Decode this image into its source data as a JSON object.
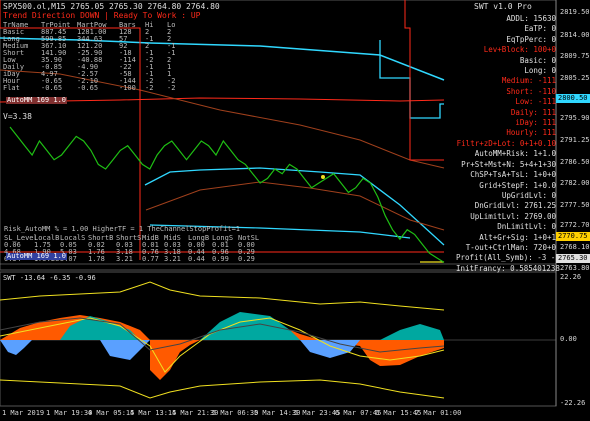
{
  "window": {
    "chart_title": "SPX500.ol,M15  2765.05 2765.30 2764.80 2764.80",
    "indicator_title": "SWT v1.0 Pro",
    "subwindow_title": "SWT -13.64 -6.35 -0.96",
    "trend_header": "Trend Direction   DOWN  |  Ready To Work : UP"
  },
  "top_table": {
    "headers": [
      "TrName",
      "TrPoint",
      "MartPow",
      "Bars",
      "Hi",
      "Lo"
    ],
    "rows": [
      [
        "Basic",
        "887.45",
        "1281.00",
        "128",
        "2",
        "2"
      ],
      [
        "Long",
        "599.85",
        "344.63",
        "57",
        "-1",
        "2"
      ],
      [
        "Medium",
        "367.10",
        "121.20",
        "92",
        "2",
        "-1"
      ],
      [
        "Short",
        "141.90",
        "-25.90",
        "-18",
        "-1",
        "-1"
      ],
      [
        "Low",
        "35.90",
        "-40.88",
        "-114",
        "-2",
        "2"
      ],
      [
        "Daily",
        "-0.85",
        "-4.90",
        "-22",
        "-1",
        "1"
      ],
      [
        "iDay",
        "4.97",
        "-2.57",
        "-58",
        "-1",
        "1"
      ],
      [
        "Hour",
        "-0.65",
        "-2.10",
        "-144",
        "-2",
        "-2"
      ],
      [
        "Flat",
        "-0.65",
        "-0.65",
        "-100",
        "-2",
        "-2"
      ]
    ],
    "overlay_note": "AutoMM 169 1.0",
    "v_label": "V=3.38"
  },
  "swt_panel": {
    "rows": [
      {
        "label": "ADDL:",
        "value": "15630",
        "color": "#e0e0e0"
      },
      {
        "label": "EaTP:",
        "value": "0",
        "color": "#e0e0e0"
      },
      {
        "label": "EqTpPerc:",
        "value": "0",
        "color": "#e0e0e0"
      },
      {
        "label": "Lev+Block:",
        "value": "100+0",
        "color": "#ff2a1a"
      },
      {
        "label": "Basic:",
        "value": "0",
        "color": "#e0e0e0"
      },
      {
        "label": "Long:",
        "value": "0",
        "color": "#e0e0e0"
      },
      {
        "label": "Medium:",
        "value": "-111",
        "color": "#ff2a1a"
      },
      {
        "label": "Short:",
        "value": "-110",
        "color": "#ff2a1a"
      },
      {
        "label": "Low:",
        "value": "-111",
        "color": "#ff2a1a"
      },
      {
        "label": "Daily:",
        "value": "111",
        "color": "#ff2a1a"
      },
      {
        "label": "iDay:",
        "value": "111",
        "color": "#ff2a1a"
      },
      {
        "label": "Hourly:",
        "value": "111",
        "color": "#ff2a1a"
      },
      {
        "label": "Filtr+zD+Lot:",
        "value": "0+1+0.10",
        "color": "#ff2a1a"
      },
      {
        "label": "AutoMM+Risk:",
        "value": "1+1.0",
        "color": "#e0e0e0"
      },
      {
        "label": "Pr+St+Mst+N:",
        "value": "5+4+1+30",
        "color": "#e0e0e0"
      },
      {
        "label": "ChSP+TsA+TsL:",
        "value": "1+0+0",
        "color": "#e0e0e0"
      },
      {
        "label": "Grid+StepF:",
        "value": "1+0.0",
        "color": "#e0e0e0"
      },
      {
        "label": "UpGridLvl:",
        "value": "0",
        "color": "#e0e0e0"
      },
      {
        "label": "DnGridLvl:",
        "value": "2761.25",
        "color": "#e0e0e0"
      },
      {
        "label": "UpLimitLvl:",
        "value": "2769.00",
        "color": "#e0e0e0"
      },
      {
        "label": "DnLimitLvl:",
        "value": "0",
        "color": "#e0e0e0"
      },
      {
        "label": "Alt+Gr+Sig:",
        "value": "1+0+1",
        "color": "#e0e0e0"
      },
      {
        "label": "T-out+CtrlMan:",
        "value": "720+0",
        "color": "#e0e0e0"
      },
      {
        "label": "Profit(All_Symb):",
        "value": "-3  -3",
        "color": "#e0e0e0"
      },
      {
        "label": "InitFrancy:",
        "value": "0.585401238",
        "color": "#e0e0e0"
      }
    ]
  },
  "bottom_table": {
    "title_line": "Risk_AutoMM % = 1.00     HigherTF = 1       TheChannelStopProfit=1",
    "headers": [
      "SL_Level",
      "LocalB",
      "LocalS",
      "ShortB",
      "ShortS",
      "MidB",
      "MidS",
      "LongB",
      "LongS",
      "NotSL"
    ],
    "rows": [
      [
        "0.06",
        "1.75",
        "0.05",
        "0.02",
        "0.03",
        "0.01",
        "0.03",
        "0.00",
        "0.01",
        "0.00"
      ],
      [
        "4.68",
        "1.90",
        "5.03",
        "1.76",
        "3.18",
        "0.76",
        "3.18",
        "0.44",
        "0.96",
        "0.29"
      ],
      [
        "6.34",
        "175.28",
        "5.07",
        "1.78",
        "3.21",
        "0.77",
        "3.21",
        "0.44",
        "0.99",
        "0.29"
      ]
    ],
    "overlay_note": "AutoMM 169 1.0"
  },
  "price_axis": {
    "ticks": [
      "2819.50",
      "2814.00",
      "2809.75",
      "2805.25",
      "2800.50",
      "2795.90",
      "2791.25",
      "2786.50",
      "2782.00",
      "2777.50",
      "2772.70",
      "2768.10",
      "2763.80"
    ],
    "markers": [
      {
        "value": "2800.50",
        "color": "#30d8ff"
      },
      {
        "value": "2770.75",
        "color": "#ffd000"
      },
      {
        "value": "2765.30",
        "color": "#e0e0e0"
      }
    ]
  },
  "sub_axis": {
    "ticks": [
      "22.26",
      "0.00",
      "-22.26"
    ]
  },
  "time_axis": {
    "ticks": [
      "1 Mar 2019",
      "1 Mar 19:30",
      "4 Mar 05:15",
      "4 Mar 13:15",
      "4 Mar 21:30",
      "5 Mar 06:30",
      "5 Mar 14:30",
      "5 Mar 23:45",
      "6 Mar 07:45",
      "6 Mar 15:45",
      "7 Mar 01:00"
    ]
  },
  "chart_data": {
    "type": "line",
    "series": [
      {
        "values": [
          2794,
          2792,
          2790,
          2788,
          2791,
          2789,
          2787,
          2788,
          2790,
          2792,
          2791,
          2789,
          2786,
          2785,
          2787,
          2789,
          2790,
          2788,
          2786,
          2785,
          2788,
          2790,
          2791,
          2789,
          2787,
          2789,
          2791,
          2790,
          2788,
          2791,
          2789,
          2787,
          2786,
          2784,
          2782,
          2783,
          2785,
          2784,
          2786,
          2785,
          2783,
          2781,
          2782,
          2783,
          2784,
          2782,
          2780,
          2781,
          2783,
          2782,
          2779,
          2775,
          2772,
          2770,
          2772,
          2771,
          2769,
          2767,
          2766,
          2765
        ]
      }
    ],
    "ylim": [
      2763.8,
      2819.5
    ],
    "sub_ylim": [
      -22.26,
      22.26
    ]
  },
  "colors": {
    "price": "#1fbf14",
    "channel": "#30d8ff",
    "red_line": "#ff2a1a",
    "brown_line": "#a0401c",
    "yellow": "#f0e020",
    "blue_bar": "#5aa0ff",
    "orange_area": "#ff5a00",
    "teal_bars": "#00a8a0"
  }
}
